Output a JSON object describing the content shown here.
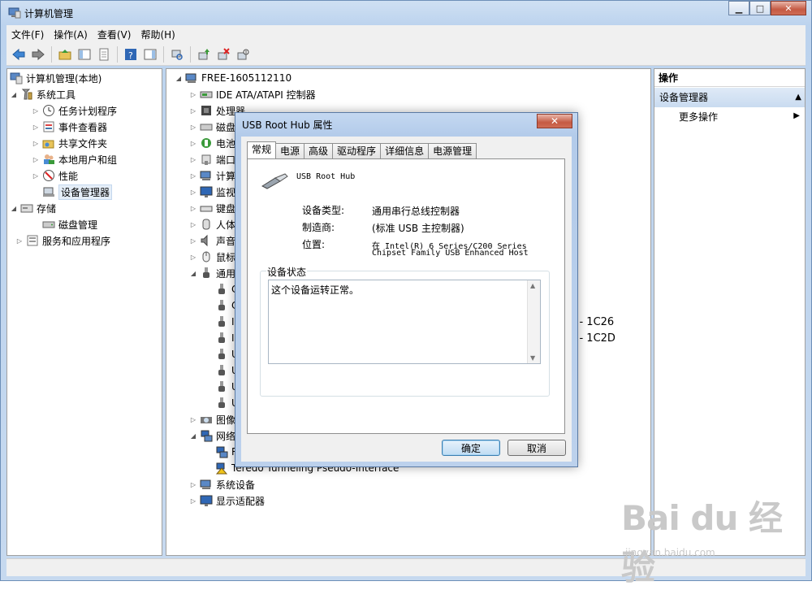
{
  "window": {
    "title": "计算机管理",
    "controls": {
      "minimize": "▁",
      "maximize": "□",
      "close": "✕"
    }
  },
  "menu": [
    "文件(F)",
    "操作(A)",
    "查看(V)",
    "帮助(H)"
  ],
  "left_tree": {
    "root": "计算机管理(本地)",
    "system_tools": "系统工具",
    "task_scheduler": "任务计划程序",
    "event_viewer": "事件查看器",
    "shared_folders": "共享文件夹",
    "local_users": "本地用户和组",
    "performance": "性能",
    "device_manager": "设备管理器",
    "storage": "存储",
    "disk_management": "磁盘管理",
    "services_apps": "服务和应用程序"
  },
  "device_tree": {
    "computer": "FREE-1605112110",
    "ide": "IDE ATA/ATAPI 控制器",
    "processor": "处理器",
    "disk": "磁盘",
    "battery": "电池",
    "port": "端口",
    "computer_cat": "计算",
    "monitor": "监视",
    "keyboard": "键盘",
    "hid": "人体",
    "sound": "声音",
    "mouse": "鼠标",
    "usb": "通用",
    "usb_children": [
      "C",
      "C",
      "I",
      "I",
      "U",
      "U",
      "U",
      "U"
    ],
    "usb_tail_1": "r - 1C26",
    "usb_tail_2": "r - 1C2D",
    "imaging": "图像",
    "network": "网络",
    "net_child_1": "R",
    "net_child_2": "Teredo Tunneling Pseudo-Interface",
    "system_devices": "系统设备",
    "display_adapters": "显示适配器"
  },
  "actions_pane": {
    "header": "操作",
    "section": "设备管理器",
    "more": "更多操作"
  },
  "dialog": {
    "title": "USB Root Hub 属性",
    "close": "✕",
    "tabs": [
      "常规",
      "电源",
      "高级",
      "驱动程序",
      "详细信息",
      "电源管理"
    ],
    "device_name": "USB Root Hub",
    "device_type_label": "设备类型:",
    "device_type_value": "通用串行总线控制器",
    "manufacturer_label": "制造商:",
    "manufacturer_value": "(标准 USB 主控制器)",
    "location_label": "位置:",
    "location_value_1": "在 Intel(R) 6 Series/C200 Series",
    "location_value_2": "Chipset Family USB Enhanced Host",
    "status_group": "设备状态",
    "status_text": "这个设备运转正常。",
    "ok": "确定",
    "cancel": "取消"
  },
  "watermark": {
    "main": "Bai du 经验",
    "sub": "jingyan.baidu.com"
  }
}
